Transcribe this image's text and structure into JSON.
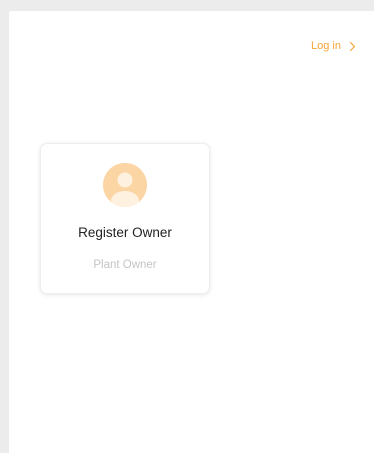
{
  "header": {
    "login_label": "Log in",
    "login_icon": "chevron-right-icon"
  },
  "card": {
    "avatar_icon": "user-avatar-icon",
    "title": "Register Owner",
    "subtitle": "Plant Owner"
  },
  "colors": {
    "accent": "#f7a436",
    "avatar_bg": "#fcd5a5",
    "avatar_fg": "#fff1df",
    "page_bg": "#ececec",
    "panel_bg": "#ffffff",
    "title_text": "#222222",
    "muted_text": "#c4c4c4"
  }
}
